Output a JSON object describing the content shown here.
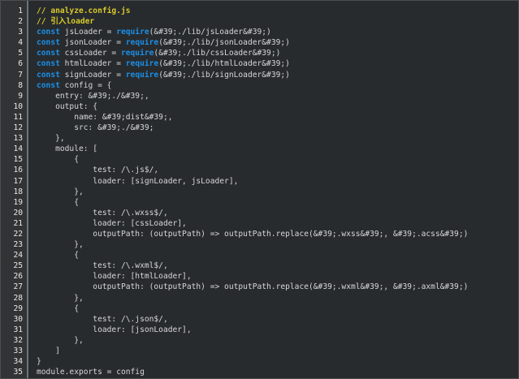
{
  "colors": {
    "background": "#282b2e",
    "gutter": "#313335",
    "comment": "#d7c92b",
    "keyword": "#1b8fe6",
    "text": "#d6d6d6"
  },
  "lines": [
    {
      "num": "1",
      "segs": [
        {
          "t": "// analyze.config.js",
          "c": "comment"
        }
      ]
    },
    {
      "num": "2",
      "segs": [
        {
          "t": "// 引入loader",
          "c": "comment"
        }
      ]
    },
    {
      "num": "3",
      "segs": [
        {
          "t": "const",
          "c": "kw"
        },
        {
          "t": " jsLoader = ",
          "c": "plain"
        },
        {
          "t": "require",
          "c": "fn"
        },
        {
          "t": "(&#39;./lib/jsLoader&#39;)",
          "c": "plain"
        }
      ]
    },
    {
      "num": "4",
      "segs": [
        {
          "t": "const",
          "c": "kw"
        },
        {
          "t": " jsonLoader = ",
          "c": "plain"
        },
        {
          "t": "require",
          "c": "fn"
        },
        {
          "t": "(&#39;./lib/jsonLoader&#39;)",
          "c": "plain"
        }
      ]
    },
    {
      "num": "5",
      "segs": [
        {
          "t": "const",
          "c": "kw"
        },
        {
          "t": " cssLoader = ",
          "c": "plain"
        },
        {
          "t": "require",
          "c": "fn"
        },
        {
          "t": "(&#39;./lib/cssLoader&#39;)",
          "c": "plain"
        }
      ]
    },
    {
      "num": "6",
      "segs": [
        {
          "t": "const",
          "c": "kw"
        },
        {
          "t": " htmlLoader = ",
          "c": "plain"
        },
        {
          "t": "require",
          "c": "fn"
        },
        {
          "t": "(&#39;./lib/htmlLoader&#39;)",
          "c": "plain"
        }
      ]
    },
    {
      "num": "7",
      "segs": [
        {
          "t": "const",
          "c": "kw"
        },
        {
          "t": " signLoader = ",
          "c": "plain"
        },
        {
          "t": "require",
          "c": "fn"
        },
        {
          "t": "(&#39;./lib/signLoader&#39;)",
          "c": "plain"
        }
      ]
    },
    {
      "num": "8",
      "segs": [
        {
          "t": "const",
          "c": "kw"
        },
        {
          "t": " config = {",
          "c": "plain"
        }
      ]
    },
    {
      "num": "9",
      "segs": [
        {
          "t": "    entry: &#39;./&#39;,",
          "c": "plain"
        }
      ]
    },
    {
      "num": "10",
      "segs": [
        {
          "t": "    output: {",
          "c": "plain"
        }
      ]
    },
    {
      "num": "11",
      "segs": [
        {
          "t": "        name: &#39;dist&#39;,",
          "c": "plain"
        }
      ]
    },
    {
      "num": "12",
      "segs": [
        {
          "t": "        src: &#39;./&#39;",
          "c": "plain"
        }
      ]
    },
    {
      "num": "13",
      "segs": [
        {
          "t": "    },",
          "c": "plain"
        }
      ]
    },
    {
      "num": "14",
      "segs": [
        {
          "t": "    module: [",
          "c": "plain"
        }
      ]
    },
    {
      "num": "15",
      "segs": [
        {
          "t": "        {",
          "c": "plain"
        }
      ]
    },
    {
      "num": "16",
      "segs": [
        {
          "t": "            test: /\\.js$/,",
          "c": "plain"
        }
      ]
    },
    {
      "num": "17",
      "segs": [
        {
          "t": "            loader: [signLoader, jsLoader],",
          "c": "plain"
        }
      ]
    },
    {
      "num": "18",
      "segs": [
        {
          "t": "        },",
          "c": "plain"
        }
      ]
    },
    {
      "num": "19",
      "segs": [
        {
          "t": "        {",
          "c": "plain"
        }
      ]
    },
    {
      "num": "20",
      "segs": [
        {
          "t": "            test: /\\.wxss$/,",
          "c": "plain"
        }
      ]
    },
    {
      "num": "21",
      "segs": [
        {
          "t": "            loader: [cssLoader],",
          "c": "plain"
        }
      ]
    },
    {
      "num": "22",
      "segs": [
        {
          "t": "            outputPath: (outputPath) => outputPath.replace(&#39;.wxss&#39;, &#39;.acss&#39;)",
          "c": "plain"
        }
      ]
    },
    {
      "num": "23",
      "segs": [
        {
          "t": "        },",
          "c": "plain"
        }
      ]
    },
    {
      "num": "24",
      "segs": [
        {
          "t": "        {",
          "c": "plain"
        }
      ]
    },
    {
      "num": "25",
      "segs": [
        {
          "t": "            test: /\\.wxml$/,",
          "c": "plain"
        }
      ]
    },
    {
      "num": "26",
      "segs": [
        {
          "t": "            loader: [htmlLoader],",
          "c": "plain"
        }
      ]
    },
    {
      "num": "27",
      "segs": [
        {
          "t": "            outputPath: (outputPath) => outputPath.replace(&#39;.wxml&#39;, &#39;.axml&#39;)",
          "c": "plain"
        }
      ]
    },
    {
      "num": "28",
      "segs": [
        {
          "t": "        },",
          "c": "plain"
        }
      ]
    },
    {
      "num": "29",
      "segs": [
        {
          "t": "        {",
          "c": "plain"
        }
      ]
    },
    {
      "num": "30",
      "segs": [
        {
          "t": "            test: /\\.json$/,",
          "c": "plain"
        }
      ]
    },
    {
      "num": "31",
      "segs": [
        {
          "t": "            loader: [jsonLoader],",
          "c": "plain"
        }
      ]
    },
    {
      "num": "32",
      "segs": [
        {
          "t": "        },",
          "c": "plain"
        }
      ]
    },
    {
      "num": "33",
      "segs": [
        {
          "t": "    ]",
          "c": "plain"
        }
      ]
    },
    {
      "num": "34",
      "segs": [
        {
          "t": "}",
          "c": "plain"
        }
      ]
    },
    {
      "num": "35",
      "segs": [
        {
          "t": "module.exports = config",
          "c": "plain"
        }
      ]
    }
  ]
}
